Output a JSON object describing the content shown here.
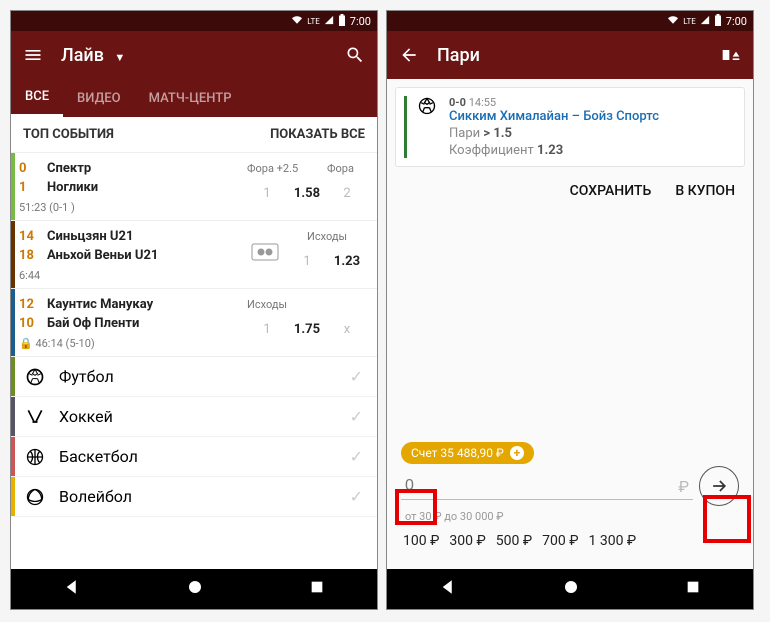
{
  "status": {
    "time": "7:00",
    "network": "LTE"
  },
  "screen1": {
    "title": "Лайв",
    "tabs": [
      "ВСЕ",
      "ВИДЕО",
      "МАТЧ-ЦЕНТР"
    ],
    "top_events_label": "ТОП СОБЫТИЯ",
    "show_all_label": "ПОКАЗАТЬ ВСЕ",
    "matches": [
      {
        "score1": "0",
        "team1": "Спектр",
        "score2": "1",
        "team2": "Ноглики",
        "time": "51:23 (0-1 )",
        "odds_header_left": "Фора +2.5",
        "odds_header_right": "Фора",
        "odds": [
          {
            "v": "1",
            "dim": true
          },
          {
            "v": "1.58",
            "dim": false
          },
          {
            "v": "2",
            "dim": true
          }
        ]
      },
      {
        "score1": "14",
        "team1": "Синьцзян U21",
        "score2": "18",
        "team2": "Аньхой Веньи U21",
        "time": "6:44",
        "tv": true,
        "odds_header": "Исходы",
        "odds": [
          {
            "v": "1",
            "dim": true
          },
          {
            "v": "1.23",
            "dim": false
          }
        ]
      },
      {
        "score1": "12",
        "team1": "Каунтис Манукау",
        "score2": "10",
        "team2": "Бай Оф Пленти",
        "time": "46:14 (5-10)",
        "lock": true,
        "odds_header": "Исходы",
        "odds": [
          {
            "v": "1",
            "dim": true
          },
          {
            "v": "1.75",
            "dim": false
          },
          {
            "v": "x",
            "dim": true
          }
        ]
      }
    ],
    "sports": [
      {
        "name": "Футбол",
        "edge": "edge-football"
      },
      {
        "name": "Хоккей",
        "edge": "edge-hockey"
      },
      {
        "name": "Баскетбол",
        "edge": "edge-basket"
      },
      {
        "name": "Волейбол",
        "edge": "edge-volley"
      }
    ]
  },
  "screen2": {
    "title": "Пари",
    "card": {
      "score_time": "0-0 14:55",
      "score": "0-0",
      "time": "14:55",
      "match": "Сикким Хималайан – Бойз Спортс",
      "bet_label": "Пари",
      "bet_value": "> 1.5",
      "coef_label": "Коэффициент",
      "coef_value": "1.23"
    },
    "actions": {
      "save": "СОХРАНИТЬ",
      "coupon": "В КУПОН"
    },
    "balance": "Счет 35 488,90 ₽",
    "input_placeholder": "0",
    "currency": "₽",
    "limits": "от 30 ₽ до 30 000 ₽",
    "quick": [
      "100 ₽",
      "300 ₽",
      "500 ₽",
      "700 ₽",
      "1 300 ₽"
    ]
  }
}
